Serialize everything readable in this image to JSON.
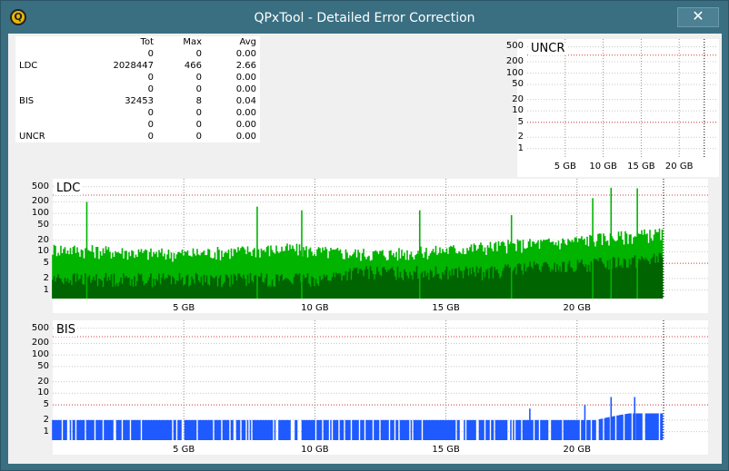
{
  "window": {
    "title": "QPxTool - Detailed Error Correction",
    "close_label": "✕",
    "icon_letter": "Q"
  },
  "stats": {
    "headers": [
      "",
      "Tot",
      "Max",
      "Avg"
    ],
    "rows": [
      {
        "label": "",
        "tot": "0",
        "max": "0",
        "avg": "0.00"
      },
      {
        "label": "LDC",
        "tot": "2028447",
        "max": "466",
        "avg": "2.66"
      },
      {
        "label": "",
        "tot": "0",
        "max": "0",
        "avg": "0.00"
      },
      {
        "label": "",
        "tot": "0",
        "max": "0",
        "avg": "0.00"
      },
      {
        "label": "BIS",
        "tot": "32453",
        "max": "8",
        "avg": "0.04"
      },
      {
        "label": "",
        "tot": "0",
        "max": "0",
        "avg": "0.00"
      },
      {
        "label": "",
        "tot": "0",
        "max": "0",
        "avg": "0.00"
      },
      {
        "label": "UNCR",
        "tot": "0",
        "max": "0",
        "avg": "0.00"
      }
    ]
  },
  "chart_data": [
    {
      "type": "bar",
      "title": "UNCR",
      "scale": "log",
      "y_ticks": [
        "500",
        "200",
        "100",
        "50",
        "20",
        "10",
        "5",
        "2",
        "1"
      ],
      "x_ticks": [
        "5 GB",
        "10 GB",
        "15 GB",
        "20 GB"
      ],
      "x_tick_values": [
        5,
        10,
        15,
        20
      ],
      "xlim": [
        0,
        25
      ],
      "disc_end": 23.3,
      "threshold": [
        5,
        300
      ],
      "series": [
        {
          "values": [
            0
          ],
          "color": "#00aa00"
        }
      ]
    },
    {
      "type": "bar",
      "title": "LDC",
      "scale": "log",
      "y_ticks": [
        "500",
        "200",
        "100",
        "50",
        "20",
        "10",
        "5",
        "2",
        "1"
      ],
      "x_ticks": [
        "5 GB",
        "10 GB",
        "15 GB",
        "20 GB"
      ],
      "x_tick_values": [
        5,
        10,
        15,
        20
      ],
      "xlim": [
        0,
        25
      ],
      "disc_end": 23.3,
      "threshold": [
        5,
        300
      ],
      "series": [
        {
          "values": [
            12,
            11,
            10,
            9,
            9,
            10,
            11,
            12,
            10,
            9,
            9,
            10,
            12,
            14,
            16,
            18,
            22,
            26,
            30
          ],
          "color": "#00b400"
        },
        {
          "values": [
            2,
            2,
            2,
            2,
            2,
            2,
            2,
            2,
            2,
            3,
            3,
            3,
            3,
            3,
            4,
            4,
            5,
            6,
            7
          ],
          "color": "#006400"
        }
      ],
      "peaks": [
        {
          "x": 1.3,
          "y": 200
        },
        {
          "x": 7.8,
          "y": 150
        },
        {
          "x": 9.5,
          "y": 120
        },
        {
          "x": 14,
          "y": 120
        },
        {
          "x": 17.5,
          "y": 90
        },
        {
          "x": 20.6,
          "y": 250
        },
        {
          "x": 21.3,
          "y": 466
        },
        {
          "x": 22.3,
          "y": 450
        }
      ]
    },
    {
      "type": "bar",
      "title": "BIS",
      "scale": "log",
      "y_ticks": [
        "500",
        "200",
        "100",
        "50",
        "20",
        "10",
        "5",
        "2",
        "1"
      ],
      "x_ticks": [
        "5 GB",
        "10 GB",
        "15 GB",
        "20 GB"
      ],
      "x_tick_values": [
        5,
        10,
        15,
        20
      ],
      "xlim": [
        0,
        25
      ],
      "disc_end": 23.3,
      "threshold": [
        5,
        300
      ],
      "series": [
        {
          "values": [
            2,
            2,
            2,
            2,
            2,
            2,
            2,
            2,
            2,
            2,
            2,
            2,
            2,
            2,
            2,
            2,
            2,
            3,
            3
          ],
          "color": "#1e5aff"
        }
      ],
      "peaks": [
        {
          "x": 18.2,
          "y": 4
        },
        {
          "x": 20.3,
          "y": 5
        },
        {
          "x": 21.3,
          "y": 8
        },
        {
          "x": 22.2,
          "y": 8
        }
      ]
    }
  ]
}
